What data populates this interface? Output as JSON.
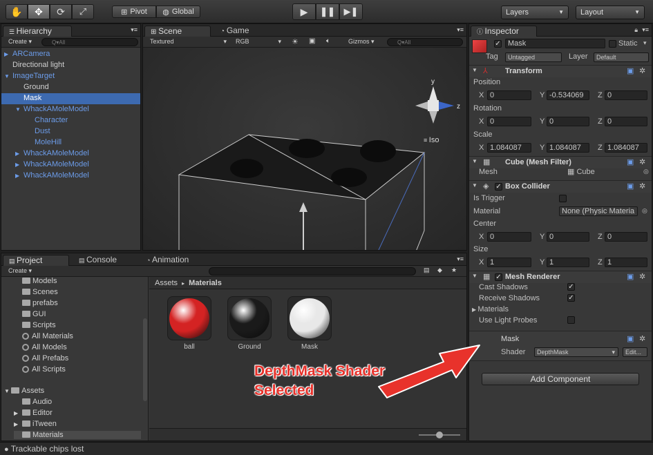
{
  "toolbar": {
    "pivot": "Pivot",
    "global": "Global",
    "layers": "Layers",
    "layout": "Layout",
    "icons": [
      "hand-icon",
      "move-icon",
      "rotate-icon",
      "scale-icon"
    ]
  },
  "hierarchy": {
    "tab": "Hierarchy",
    "create": "Create",
    "search_placeholder": "Q▾All",
    "items": [
      {
        "label": "ARCamera",
        "blue": true,
        "arrow": true
      },
      {
        "label": "Directional light",
        "blue": false,
        "arrow": false
      },
      {
        "label": "ImageTarget",
        "blue": true,
        "arrow": true
      },
      {
        "label": "Ground",
        "blue": false,
        "arrow": false
      },
      {
        "label": "Mask",
        "blue": false,
        "arrow": false,
        "selected": true
      },
      {
        "label": "WhackAMoleModel",
        "blue": true,
        "arrow": true
      },
      {
        "label": "Character",
        "blue": true,
        "arrow": false
      },
      {
        "label": "Dust",
        "blue": true,
        "arrow": false
      },
      {
        "label": "MoleHill",
        "blue": true,
        "arrow": false
      },
      {
        "label": "WhackAMoleModel",
        "blue": true,
        "arrow": true
      },
      {
        "label": "WhackAMoleModel",
        "blue": true,
        "arrow": true
      },
      {
        "label": "WhackAMoleModel",
        "blue": true,
        "arrow": true
      }
    ]
  },
  "scene": {
    "tab_scene": "Scene",
    "tab_game": "Game",
    "textured": "Textured",
    "rgb": "RGB",
    "gizmos": "Gizmos",
    "search_placeholder": "Q▾All",
    "iso": "Iso",
    "axis_y": "y",
    "axis_z": "z"
  },
  "project": {
    "tab_project": "Project",
    "tab_console": "Console",
    "tab_animation": "Animation",
    "create": "Create",
    "folders": [
      {
        "label": "Models",
        "type": "folder"
      },
      {
        "label": "Scenes",
        "type": "folder"
      },
      {
        "label": "prefabs",
        "type": "folder"
      },
      {
        "label": "GUI",
        "type": "folder"
      },
      {
        "label": "Scripts",
        "type": "folder"
      },
      {
        "label": "All Materials",
        "type": "search"
      },
      {
        "label": "All Models",
        "type": "search"
      },
      {
        "label": "All Prefabs",
        "type": "search"
      },
      {
        "label": "All Scripts",
        "type": "search"
      }
    ],
    "assets_root": "Assets",
    "asset_folders": [
      "Audio",
      "Editor",
      "iTween",
      "Materials"
    ],
    "breadcrumb_root": "Assets",
    "breadcrumb_sep": "▸",
    "breadcrumb_current": "Materials",
    "materials": [
      {
        "label": "ball",
        "color": "#d42323"
      },
      {
        "label": "Ground",
        "color": "#1a1a1a"
      },
      {
        "label": "Mask",
        "color": "#e8e8e8"
      }
    ]
  },
  "inspector": {
    "tab": "Inspector",
    "object_name": "Mask",
    "static": "Static",
    "tag_label": "Tag",
    "tag_value": "Untagged",
    "layer_label": "Layer",
    "layer_value": "Default",
    "transform": {
      "title": "Transform",
      "position": "Position",
      "rotation": "Rotation",
      "scale": "Scale",
      "pos": [
        "0",
        "-0.534069",
        "0"
      ],
      "rot": [
        "0",
        "0",
        "0"
      ],
      "scl": [
        "1.084087",
        "1.084087",
        "1.084087"
      ]
    },
    "axes": [
      "X",
      "Y",
      "Z"
    ],
    "mesh_filter": {
      "title": "Cube (Mesh Filter)",
      "mesh_label": "Mesh",
      "mesh_value": "Cube"
    },
    "box_collider": {
      "title": "Box Collider",
      "is_trigger": "Is Trigger",
      "material": "Material",
      "material_value": "None (Physic Materia",
      "center": "Center",
      "size": "Size",
      "center_vals": [
        "0",
        "0",
        "0"
      ],
      "size_vals": [
        "1",
        "1",
        "1"
      ]
    },
    "mesh_renderer": {
      "title": "Mesh Renderer",
      "cast_shadows": "Cast Shadows",
      "receive_shadows": "Receive Shadows",
      "materials": "Materials",
      "use_light_probes": "Use Light Probes"
    },
    "material": {
      "name": "Mask",
      "shader_label": "Shader",
      "shader_value": "DepthMask",
      "edit": "Edit..."
    },
    "add_component": "Add Component"
  },
  "annotation": {
    "line1": "DepthMask Shader",
    "line2": "Selected",
    "color": "#e8322b"
  },
  "status": {
    "text": "Trackable chips lost"
  }
}
